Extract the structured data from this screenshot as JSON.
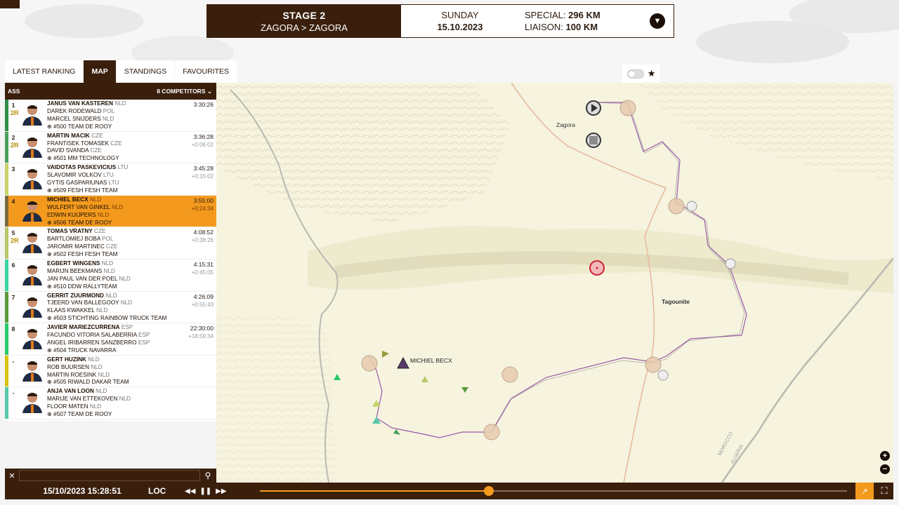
{
  "header": {
    "stage_title": "STAGE 2",
    "stage_route": "ZAGORA > ZAGORA",
    "day_name": "SUNDAY",
    "date": "15.10.2023",
    "special_label": "SPECIAL:",
    "special_value": "296 KM",
    "liaison_label": "LIAISON:",
    "liaison_value": "100 KM"
  },
  "tabs": [
    {
      "label": "LATEST RANKING"
    },
    {
      "label": "MAP"
    },
    {
      "label": "STANDINGS"
    },
    {
      "label": "FAVOURITES"
    }
  ],
  "panel": {
    "category": "ASS",
    "competitors": "8 COMPETITORS"
  },
  "rows": [
    {
      "pos": "1",
      "badge": "2R",
      "bar": "#2f8f4a",
      "lead": "JANUS VAN KASTEREN",
      "lead_nat": "NLD",
      "co1": "DAREK RODEWALD",
      "co1_nat": "POL",
      "co2": "MARCEL SNIJDERS",
      "co2_nat": "NLD",
      "team": "#500 TEAM DE ROOY",
      "time": "3:30:26",
      "gap": ""
    },
    {
      "pos": "2",
      "badge": "2R",
      "bar": "#4aa05a",
      "lead": "MARTIN MACIK",
      "lead_nat": "CZE",
      "co1": "FRANTISEK TOMASEK",
      "co1_nat": "CZE",
      "co2": "DAVID SVANDA",
      "co2_nat": "CZE",
      "team": "#501 MM TECHNOLOGY",
      "time": "3:36:28",
      "gap": "+0:06:02"
    },
    {
      "pos": "3",
      "badge": "",
      "bar": "#c8d46a",
      "lead": "VAIDOTAS PASKEVICIUS",
      "lead_nat": "LTU",
      "co1": "SLAVOMIR VOLKOV",
      "co1_nat": "LTU",
      "co2": "GYTIS GASPARIUNAS",
      "co2_nat": "LTU",
      "team": "#509 FESH FESH TEAM",
      "time": "3:45:28",
      "gap": "+0:15:02"
    },
    {
      "pos": "4",
      "badge": "",
      "bar": "#7a6a3a",
      "lead": "MICHIEL BECX",
      "lead_nat": "NLD",
      "co1": "WULFERT VAN GINKEL",
      "co1_nat": "NLD",
      "co2": "EDWIN KUIJPERS",
      "co2_nat": "NLD",
      "team": "#506 TEAM DE ROOY",
      "time": "3:55:00",
      "gap": "+0:24:34",
      "selected": true
    },
    {
      "pos": "5",
      "badge": "2R",
      "bar": "#b9c86a",
      "lead": "TOMAS VRATNY",
      "lead_nat": "CZE",
      "co1": "BARTLOMIEJ BOBA",
      "co1_nat": "POL",
      "co2": "JAROMIR MARTINEC",
      "co2_nat": "CZE",
      "team": "#502 FESH FESH TEAM",
      "time": "4:08:52",
      "gap": "+0:38:26"
    },
    {
      "pos": "6",
      "badge": "",
      "bar": "#3ad6a0",
      "lead": "EGBERT WINGENS",
      "lead_nat": "NLD",
      "co1": "MARIJN BEEKMANS",
      "co1_nat": "NLD",
      "co2": "JAN PAUL VAN DER POEL",
      "co2_nat": "NLD",
      "team": "#510 DDW RALLYTEAM",
      "time": "4:15:31",
      "gap": "+0:45:05"
    },
    {
      "pos": "7",
      "badge": "",
      "bar": "#5a9a3a",
      "lead": "GERRIT ZUURMOND",
      "lead_nat": "NLD",
      "co1": "TJEERD VAN BALLEGOOY",
      "co1_nat": "NLD",
      "co2": "KLAAS KWAKKEL",
      "co2_nat": "NLD",
      "team": "#503 STICHTING RAINBOW TRUCK TEAM",
      "time": "4:26:09",
      "gap": "+0:55:43"
    },
    {
      "pos": "8",
      "badge": "",
      "bar": "#2ac96a",
      "lead": "JAVIER MARIEZCURRENA",
      "lead_nat": "ESP",
      "co1": "FACUNDO VITORIA SALABERRIA",
      "co1_nat": "ESP",
      "co2": "ANGEL IRIBARREN SANZBERRO",
      "co2_nat": "ESP",
      "team": "#504 TRUCK NAVARRA",
      "time": "22:30:00",
      "gap": "+18:59:34"
    },
    {
      "pos": "-",
      "badge": "",
      "bar": "#d9c200",
      "lead": "GERT HUZINK",
      "lead_nat": "NLD",
      "co1": "ROB BUURSEN",
      "co1_nat": "NLD",
      "co2": "MARTIN ROESINK",
      "co2_nat": "NLD",
      "team": "#505 RIWALD DAKAR TEAM",
      "time": "",
      "gap": ""
    },
    {
      "pos": "-",
      "badge": "",
      "bar": "#5ac8a8",
      "lead": "ANJA VAN LOON",
      "lead_nat": "NLD",
      "co1": "MARIJE VAN ETTEKOVEN",
      "co1_nat": "NLD",
      "co2": "FLOOR MATEN",
      "co2_nat": "NLD",
      "team": "#507 TEAM DE ROOY",
      "time": "",
      "gap": ""
    }
  ],
  "map": {
    "labels": {
      "zagora": "Zagora",
      "tagounite": "Tagounite",
      "michiel": "MICHIEL BECX",
      "morocco": "MOROCCO",
      "algeria": "ALGERIA"
    }
  },
  "timebar": {
    "datetime": "15/10/2023 15:28:51",
    "loc": "LOC",
    "progress": 0.39
  }
}
